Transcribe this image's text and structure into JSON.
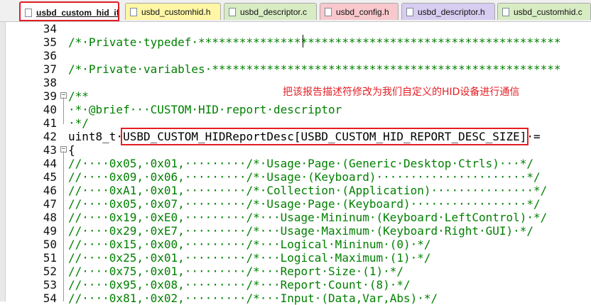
{
  "tabs": [
    {
      "label": "usbd_custom_hid_if.c",
      "color": "#ffffff",
      "active": true
    },
    {
      "label": "usbd_customhid.h",
      "color": "#fff6a6"
    },
    {
      "label": "usbd_descriptor.c",
      "color": "#d8ecc4"
    },
    {
      "label": "usbd_config.h",
      "color": "#f8c8cc"
    },
    {
      "label": "usbd_descriptor.h",
      "color": "#d6cdf0"
    },
    {
      "label": "usbd_customhid.c",
      "color": "#d8ecc4"
    }
  ],
  "annotation": "把该报告描述符修改为我们自定义的HID设备进行通信",
  "lines": [
    {
      "n": "34",
      "t": ""
    },
    {
      "n": "35",
      "t": "/*·Private·typedef·*****************************************************"
    },
    {
      "n": "36",
      "t": ""
    },
    {
      "n": "37",
      "t": "/*·Private·variables·***************************************************"
    },
    {
      "n": "38",
      "t": ""
    },
    {
      "n": "39",
      "t": "/**"
    },
    {
      "n": "40",
      "t": "·*·@brief···CUSTOM·HID·report·descriptor"
    },
    {
      "n": "41",
      "t": "·*/"
    },
    {
      "n": "42",
      "t": "uint8_t·",
      "hl": "USBD_CUSTOM_HIDReportDesc[USBD_CUSTOM_HID_REPORT_DESC_SIZE]",
      "tail": "·="
    },
    {
      "n": "43",
      "t": "{"
    },
    {
      "n": "44",
      "t": "//····0x05,·0x01,·········/*·Usage·Page·(Generic·Desktop·Ctrls)···*/"
    },
    {
      "n": "45",
      "t": "//····0x09,·0x06,·········/*·Usage·(Keyboard)······················*/"
    },
    {
      "n": "46",
      "t": "//····0xA1,·0x01,·········/*·Collection·(Application)···············*/"
    },
    {
      "n": "47",
      "t": "//····0x05,·0x07,·········/*·Usage·Page·(Keyboard)·················*/"
    },
    {
      "n": "48",
      "t": "//····0x19,·0xE0,·········/*···Usage·Mininum·(Keyboard·LeftControl)·*/"
    },
    {
      "n": "49",
      "t": "//····0x29,·0xE7,·········/*···Usage·Maximum·(Keyboard·Right·GUI)·*/"
    },
    {
      "n": "50",
      "t": "//····0x15,·0x00,·········/*···Logical·Mininum·(0)·*/"
    },
    {
      "n": "51",
      "t": "//····0x25,·0x01,·········/*···Logical·Maximum·(1)·*/"
    },
    {
      "n": "52",
      "t": "//····0x75,·0x01,·········/*···Report·Size·(1)·*/"
    },
    {
      "n": "53",
      "t": "//····0x95,·0x08,·········/*···Report·Count·(8)·*/"
    },
    {
      "n": "54",
      "t": "//····0x81,·0x02,·········/*···Input·(Data,Var,Abs)·*/"
    }
  ]
}
